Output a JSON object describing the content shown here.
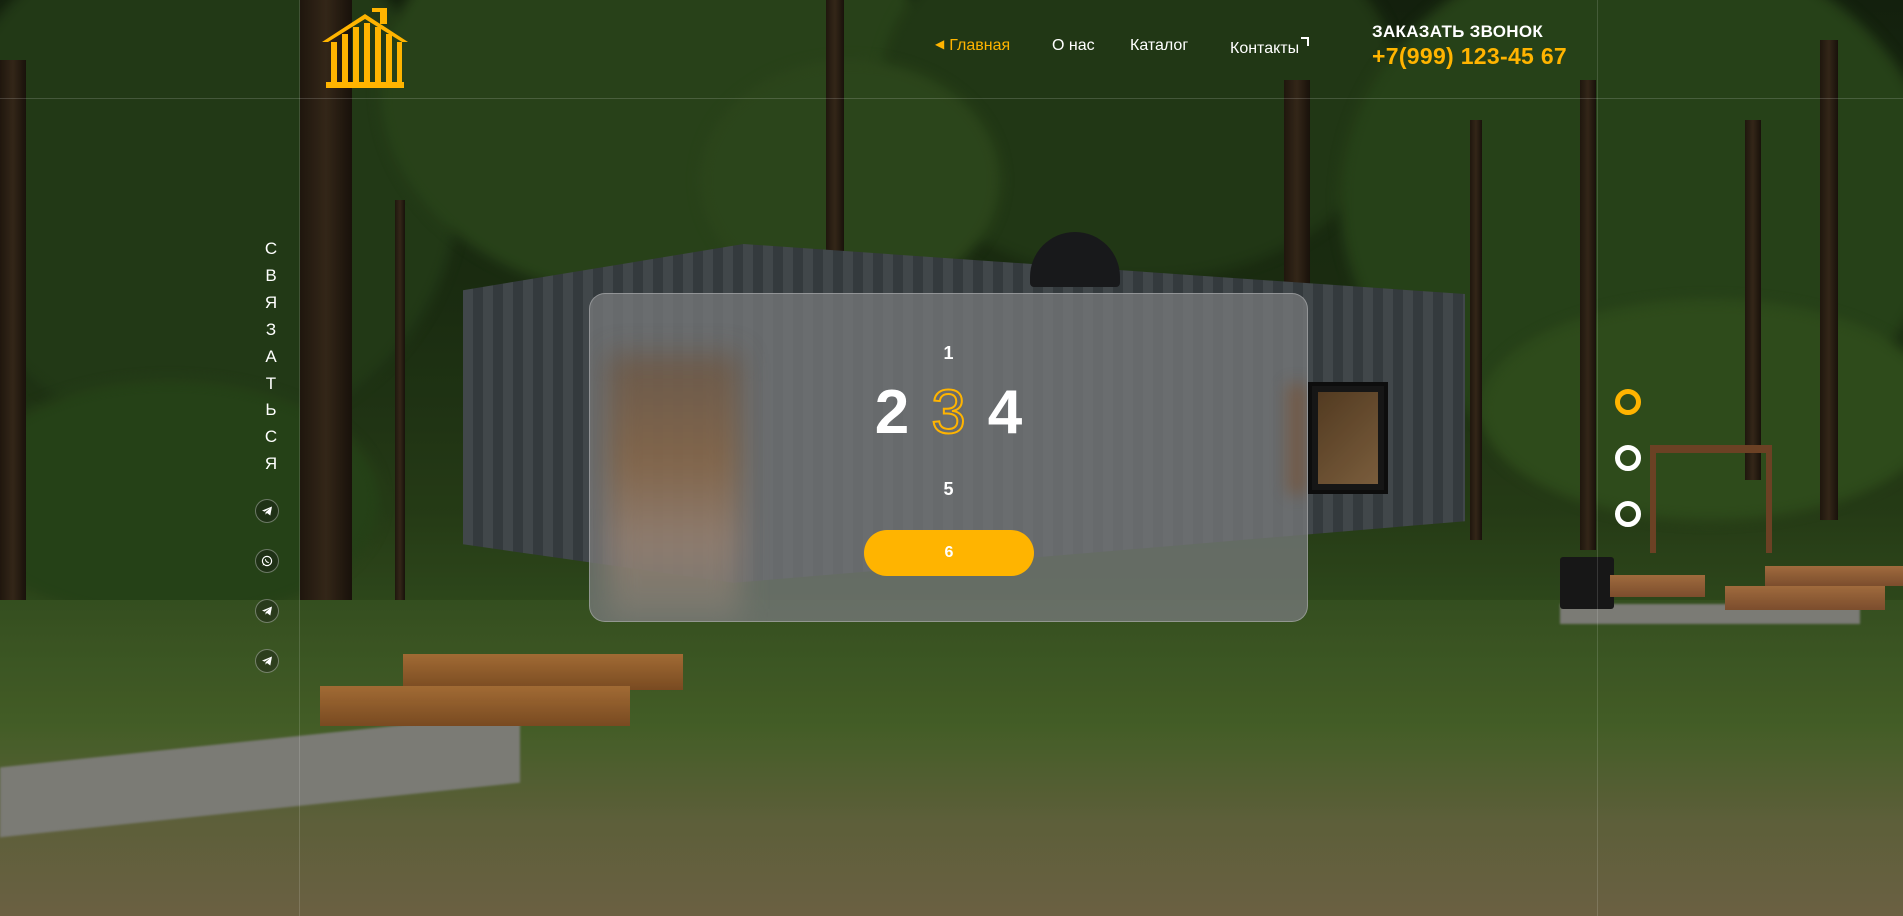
{
  "header": {
    "logo": "house-logo",
    "nav": [
      {
        "label": "Главная",
        "active": true
      },
      {
        "label": "О нас",
        "active": false
      },
      {
        "label": "Каталог",
        "active": false
      },
      {
        "label": "Контакты",
        "active": false
      }
    ],
    "callback_label": "ЗАКАЗАТЬ ЗВОНОК",
    "phone": "+7(999) 123-45 67"
  },
  "sidebar": {
    "vertical_letters": [
      "С",
      "В",
      "Я",
      "З",
      "А",
      "Т",
      "Ь",
      "С",
      "Я"
    ],
    "socials": [
      "telegram-icon",
      "whatsapp-icon",
      "telegram-icon",
      "telegram-icon"
    ]
  },
  "card": {
    "top": "1",
    "prev": "2",
    "current": "3",
    "next": "4",
    "bottom": "5",
    "button": "6"
  },
  "slider_dots": [
    {
      "active": true
    },
    {
      "active": false
    },
    {
      "active": false
    }
  ],
  "colors": {
    "accent": "#ffb400",
    "text": "#ffffff",
    "card_bg": "#76787a"
  }
}
